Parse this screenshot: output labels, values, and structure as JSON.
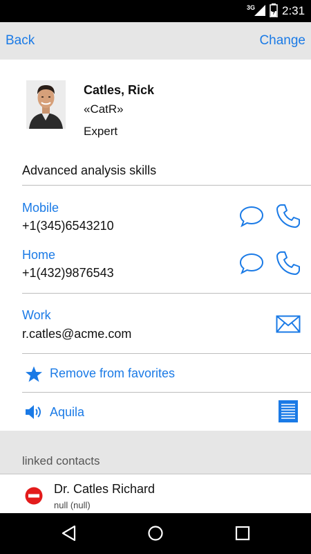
{
  "status_bar": {
    "network": "3G",
    "time": "2:31",
    "signal_icon": "signal-icon",
    "battery_icon": "battery-icon"
  },
  "header": {
    "back_label": "Back",
    "change_label": "Change"
  },
  "contact": {
    "name": "Catles, Rick",
    "nickname": "«CatR»",
    "title": "Expert",
    "skills": "Advanced analysis skills"
  },
  "phones": [
    {
      "label": "Mobile",
      "number": "+1(345)6543210"
    },
    {
      "label": "Home",
      "number": "+1(432)9876543"
    }
  ],
  "email": {
    "label": "Work",
    "address": "r.catles@acme.com"
  },
  "favorites": {
    "label": "Remove from favorites"
  },
  "aquila": {
    "label": "Aquila"
  },
  "linked": {
    "header": "linked contacts",
    "items": [
      {
        "name": "Dr. Catles Richard",
        "sub": "null (null)"
      }
    ]
  },
  "colors": {
    "accent": "#1a7ae6",
    "danger": "#e31b1b",
    "bar": "#e6e6e6"
  }
}
